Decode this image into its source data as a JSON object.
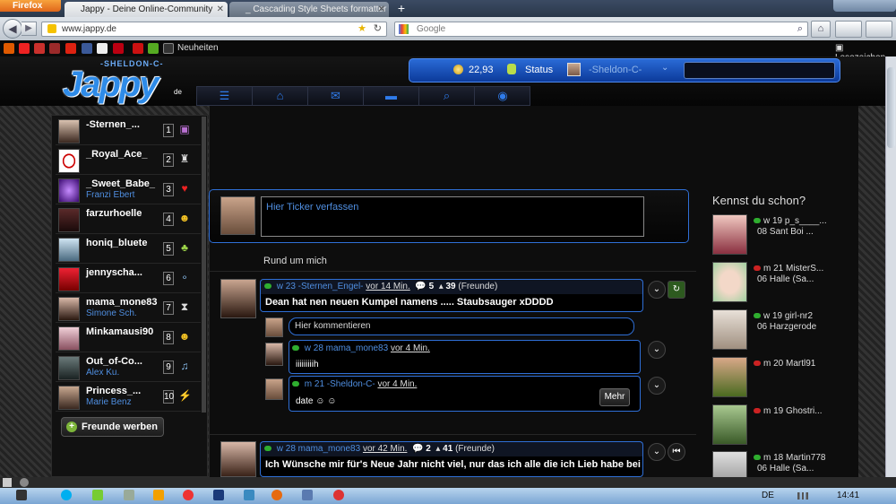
{
  "browser": {
    "app_button": "Firefox",
    "tabs": [
      {
        "label": "Jappy - Deine Online-Community"
      },
      {
        "label": "_ Cascading Style Sheets formatter / ..."
      }
    ],
    "url": "www.jappy.de",
    "search_placeholder": "Google",
    "bookmarks_label": "Neuheiten",
    "reading_list_label": "Lesezeichen"
  },
  "header": {
    "logo_sub": "-SHELDON-C-",
    "logo_text": "Jappy",
    "logo_tld": "de",
    "coins": "22,93",
    "status_label": "Status",
    "username": "-Sheldon-C-"
  },
  "friends": [
    {
      "name": "-Sternen_...",
      "sub": "",
      "num": "1",
      "icon": "gift-icon",
      "color": "#b86fd1"
    },
    {
      "name": "_Royal_Ace_",
      "sub": "",
      "num": "2",
      "icon": "trophy-icon",
      "color": "#ddd"
    },
    {
      "name": "_Sweet_Babe_",
      "sub": "Franzi Ebert",
      "num": "3",
      "icon": "heart-icon",
      "color": "#e22"
    },
    {
      "name": "farzurhoelle",
      "sub": "",
      "num": "4",
      "icon": "smiley-icon",
      "color": "#f3c224"
    },
    {
      "name": "honiq_bluete",
      "sub": "",
      "num": "5",
      "icon": "bottle-icon",
      "color": "#9fd74a"
    },
    {
      "name": "jennyscha...",
      "sub": "",
      "num": "6",
      "icon": "bubbles-icon",
      "color": "#8cc0f0"
    },
    {
      "name": "mama_mone83",
      "sub": "Simone Sch.",
      "num": "7",
      "icon": "hourglass-icon",
      "color": "#ddd"
    },
    {
      "name": "Minkamausi90",
      "sub": "",
      "num": "8",
      "icon": "smiley-icon",
      "color": "#f3c224"
    },
    {
      "name": "Out_of-Co...",
      "sub": "Alex Ku.",
      "num": "9",
      "icon": "music-icon",
      "color": "#8cc0f0"
    },
    {
      "name": "Princess_...",
      "sub": "Marie Benz",
      "num": "10",
      "icon": "lightning-icon",
      "color": "#f3c224"
    }
  ],
  "friends_button": "Freunde werben",
  "ticker": {
    "placeholder": "Hier Ticker verfassen"
  },
  "feed_heading": "Rund um mich",
  "posts": [
    {
      "user": "w 23 -Sternen_Engel-",
      "time": "vor 14 Min.",
      "comments": "5",
      "likes": "39",
      "audience": "(Freunde)",
      "text": "Dean hat nen neuen Kumpel namens ..... Staubsauger xDDDD"
    },
    {
      "user": "w 28 mama_mone83",
      "time": "vor 42 Min.",
      "comments": "2",
      "likes": "41",
      "audience": "(Freunde)",
      "text": "Ich Wünsche mir für's Neue Jahr nicht viel, nur das ich alle die ich Lieb habe bei"
    }
  ],
  "comment_placeholder": "Hier kommentieren",
  "comments": [
    {
      "user": "w 28 mama_mone83",
      "time": "vor 4 Min.",
      "text": "iiiiiiiiih"
    },
    {
      "user": "m 21 -Sheldon-C-",
      "time": "vor 4 Min.",
      "text": "date ☺ ☺"
    }
  ],
  "more_button": "Mehr",
  "suggestions": {
    "heading": "Kennst du schon?",
    "items": [
      {
        "line1": "w 19 p_s____...",
        "line2": "08 Sant Boi ...",
        "status": "online"
      },
      {
        "line1": "m 21 MisterS...",
        "line2": "06 Halle (Sa...",
        "status": "offline"
      },
      {
        "line1": "w 19 girl-nr2",
        "line2": "06 Harzgerode",
        "status": "online"
      },
      {
        "line1": "m 20 Martl91",
        "line2": "",
        "status": "offline"
      },
      {
        "line1": "m 19 Ghostri...",
        "line2": "",
        "status": "offline"
      },
      {
        "line1": "m 18 Martin778",
        "line2": "06 Halle (Sa...",
        "status": "online"
      }
    ]
  },
  "taskbar": {
    "lang": "DE",
    "clock": "14:41"
  },
  "colors": {
    "accent": "#2f6fd6",
    "link": "#4f8ee0",
    "background": "#0d0d0d"
  }
}
